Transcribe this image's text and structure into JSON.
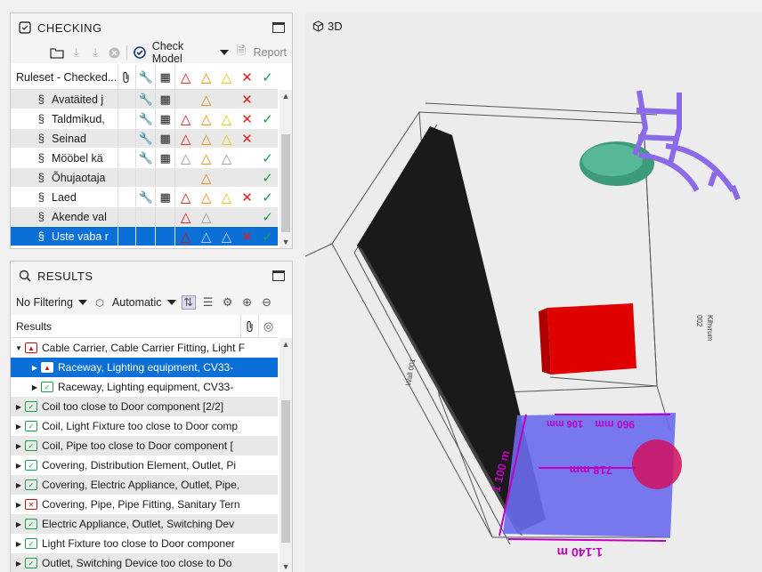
{
  "checking": {
    "title": "CHECKING",
    "toolbar": {
      "check_model": "Check Model",
      "report": "Report"
    },
    "column_header": "Ruleset - Checked...",
    "rows": [
      {
        "name": "Avatäited j",
        "tool": true,
        "grid": true,
        "s1": "",
        "s2": "orange",
        "s3": "",
        "x": true,
        "ok": false
      },
      {
        "name": "Taldmikud,",
        "tool": true,
        "grid": true,
        "s1": "red",
        "s2": "orange",
        "s3": "yellow",
        "x": true,
        "ok": true
      },
      {
        "name": "Seinad",
        "tool": true,
        "grid": true,
        "s1": "red",
        "s2": "orange",
        "s3": "yellow",
        "x": true,
        "ok": false
      },
      {
        "name": "Mööbel kä",
        "tool": true,
        "grid": true,
        "s1": "grey",
        "s2": "orange",
        "s3": "grey",
        "x": false,
        "ok": true
      },
      {
        "name": "Õhujaotaja",
        "tool": false,
        "grid": false,
        "s1": "",
        "s2": "orange",
        "s3": "",
        "x": false,
        "ok": true
      },
      {
        "name": "Laed",
        "tool": true,
        "grid": true,
        "s1": "red",
        "s2": "orange",
        "s3": "yellow",
        "x": true,
        "ok": true
      },
      {
        "name": "Akende val",
        "tool": false,
        "grid": false,
        "s1": "red",
        "s2": "grey",
        "s3": "",
        "x": false,
        "ok": true
      },
      {
        "name": "Uste vaba r",
        "tool": false,
        "grid": false,
        "s1": "red",
        "s2": "grey",
        "s3": "grey",
        "x": true,
        "ok": true
      }
    ]
  },
  "results": {
    "title": "RESULTS",
    "toolbar": {
      "filter": "No Filtering",
      "mode": "Automatic"
    },
    "column_header": "Results",
    "rows": [
      {
        "label": "Cable Carrier, Cable Carrier Fitting, Light F",
        "level": 0,
        "expanded": true,
        "badge": "warn"
      },
      {
        "label": "Raceway, Lighting equipment, CV33-",
        "level": 1,
        "expanded": false,
        "badge": "warn",
        "selected": true
      },
      {
        "label": "Raceway, Lighting equipment, CV33-",
        "level": 1,
        "expanded": false,
        "badge": "ok"
      },
      {
        "label": "Coil too close to Door component [2/2]",
        "level": 0,
        "expanded": false,
        "badge": "ok"
      },
      {
        "label": "Coil, Light Fixture too close to Door comp",
        "level": 0,
        "expanded": false,
        "badge": "ok"
      },
      {
        "label": "Coil, Pipe too close to Door component [",
        "level": 0,
        "expanded": false,
        "badge": "ok"
      },
      {
        "label": "Covering, Distribution Element, Outlet, Pi",
        "level": 0,
        "expanded": false,
        "badge": "ok"
      },
      {
        "label": "Covering, Electric Appliance, Outlet, Pipe,",
        "level": 0,
        "expanded": false,
        "badge": "ok"
      },
      {
        "label": "Covering, Pipe, Pipe Fitting, Sanitary Tern",
        "level": 0,
        "expanded": false,
        "badge": "err"
      },
      {
        "label": "Electric Appliance, Outlet, Switching Dev",
        "level": 0,
        "expanded": false,
        "badge": "ok"
      },
      {
        "label": "Light Fixture too close to Door componer",
        "level": 0,
        "expanded": false,
        "badge": "ok"
      },
      {
        "label": "Outlet, Switching Device too close to Do",
        "level": 0,
        "expanded": false,
        "badge": "ok"
      }
    ]
  },
  "viewport": {
    "title": "3D",
    "dimensions": {
      "d1": "960 mm",
      "d2": "106 mm",
      "d3": "718 mm",
      "d4": "1 100 m",
      "d5": "1.140 m"
    },
    "wall_labels": {
      "a": "Kihvrum",
      "b": "002",
      "c": "Wall 001"
    }
  },
  "colors": {
    "selection": "#0a6fd6",
    "dim": "#c000c0",
    "floor": "#6666ee",
    "red_obj": "#e00000",
    "purple_obj": "#8a6ae8",
    "green_obj": "#40a080"
  }
}
